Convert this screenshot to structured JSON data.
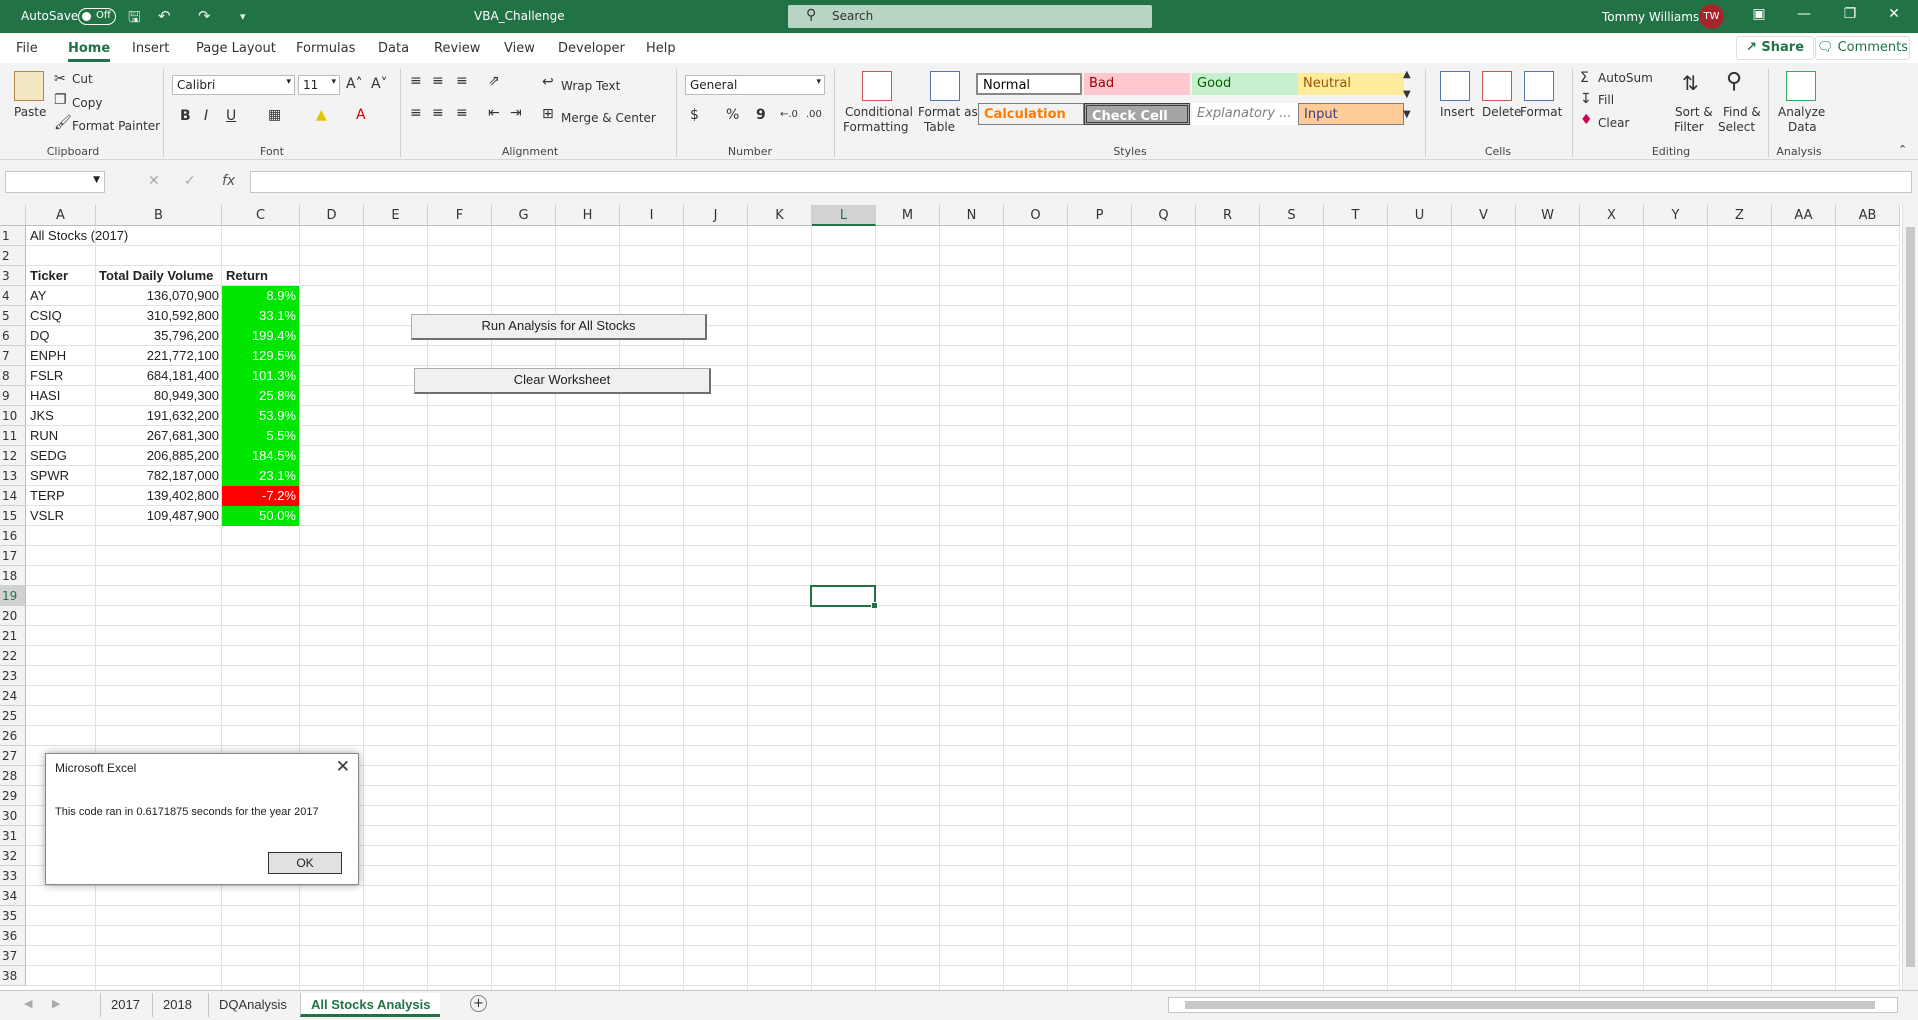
{
  "titlebar": {
    "autosave": "AutoSave",
    "toggle": "Off",
    "document": "VBA_Challenge",
    "search_placeholder": "Search",
    "user": "Tommy Williams",
    "initials": "TW"
  },
  "menu": {
    "tabs": [
      "File",
      "Home",
      "Insert",
      "Page Layout",
      "Formulas",
      "Data",
      "Review",
      "View",
      "Developer",
      "Help"
    ],
    "active": "Home",
    "share": "Share",
    "comments": "Comments"
  },
  "ribbon": {
    "clipboard": {
      "paste": "Paste",
      "cut": "Cut",
      "copy": "Copy",
      "format_painter": "Format Painter",
      "label": "Clipboard"
    },
    "font": {
      "name": "Calibri",
      "size": "11",
      "bold": "B",
      "italic": "I",
      "underline": "U",
      "label": "Font"
    },
    "alignment": {
      "wrap": "Wrap Text",
      "merge": "Merge & Center",
      "label": "Alignment"
    },
    "number": {
      "format": "General",
      "currency": "$",
      "percent": "%",
      "comma": "9",
      "label": "Number"
    },
    "styles": {
      "conditional": "Conditional",
      "conditional2": "Formatting",
      "format_as": "Format as",
      "format_as2": "Table",
      "normal": "Normal",
      "bad": "Bad",
      "good": "Good",
      "neutral": "Neutral",
      "calculation": "Calculation",
      "check_cell": "Check Cell",
      "explanatory": "Explanatory ...",
      "input": "Input",
      "label": "Styles"
    },
    "cells": {
      "insert": "Insert",
      "delete": "Delete",
      "format": "Format",
      "label": "Cells"
    },
    "editing": {
      "autosum": "AutoSum",
      "fill": "Fill",
      "clear": "Clear",
      "sort": "Sort &",
      "sort2": "Filter",
      "find": "Find &",
      "find2": "Select",
      "label": "Editing"
    },
    "analysis": {
      "analyze": "Analyze",
      "analyze2": "Data",
      "label": "Analysis"
    }
  },
  "formula": {
    "fx": "fx"
  },
  "columns": [
    "A",
    "B",
    "C",
    "D",
    "E",
    "F",
    "G",
    "H",
    "I",
    "J",
    "K",
    "L",
    "M",
    "N",
    "O",
    "P",
    "Q",
    "R",
    "S",
    "T",
    "U",
    "V",
    "W",
    "X",
    "Y",
    "Z",
    "AA",
    "AB"
  ],
  "sheet": {
    "title": "All Stocks (2017)",
    "headers": [
      "Ticker",
      "Total Daily Volume",
      "Return"
    ],
    "rows": [
      {
        "ticker": "AY",
        "volume": "136,070,900",
        "ret": "8.9%",
        "color": "#00e600"
      },
      {
        "ticker": "CSIQ",
        "volume": "310,592,800",
        "ret": "33.1%",
        "color": "#00e600"
      },
      {
        "ticker": "DQ",
        "volume": "35,796,200",
        "ret": "199.4%",
        "color": "#00e600"
      },
      {
        "ticker": "ENPH",
        "volume": "221,772,100",
        "ret": "129.5%",
        "color": "#00e600"
      },
      {
        "ticker": "FSLR",
        "volume": "684,181,400",
        "ret": "101.3%",
        "color": "#00e600"
      },
      {
        "ticker": "HASI",
        "volume": "80,949,300",
        "ret": "25.8%",
        "color": "#00e600"
      },
      {
        "ticker": "JKS",
        "volume": "191,632,200",
        "ret": "53.9%",
        "color": "#00e600"
      },
      {
        "ticker": "RUN",
        "volume": "267,681,300",
        "ret": "5.5%",
        "color": "#00e600"
      },
      {
        "ticker": "SEDG",
        "volume": "206,885,200",
        "ret": "184.5%",
        "color": "#00e600"
      },
      {
        "ticker": "SPWR",
        "volume": "782,187,000",
        "ret": "23.1%",
        "color": "#00e600"
      },
      {
        "ticker": "TERP",
        "volume": "139,402,800",
        "ret": "-7.2%",
        "color": "#ff0000"
      },
      {
        "ticker": "VSLR",
        "volume": "109,487,900",
        "ret": "50.0%",
        "color": "#00e600"
      }
    ],
    "buttons": {
      "run": "Run Analysis for All Stocks",
      "clear": "Clear Worksheet"
    }
  },
  "dialog": {
    "title": "Microsoft Excel",
    "message": "This code ran in 0.6171875 seconds for the year 2017",
    "ok": "OK"
  },
  "tabs": {
    "items": [
      "2017",
      "2018",
      "DQAnalysis",
      "All Stocks Analysis"
    ],
    "active": "All Stocks Analysis",
    "add": "+"
  }
}
